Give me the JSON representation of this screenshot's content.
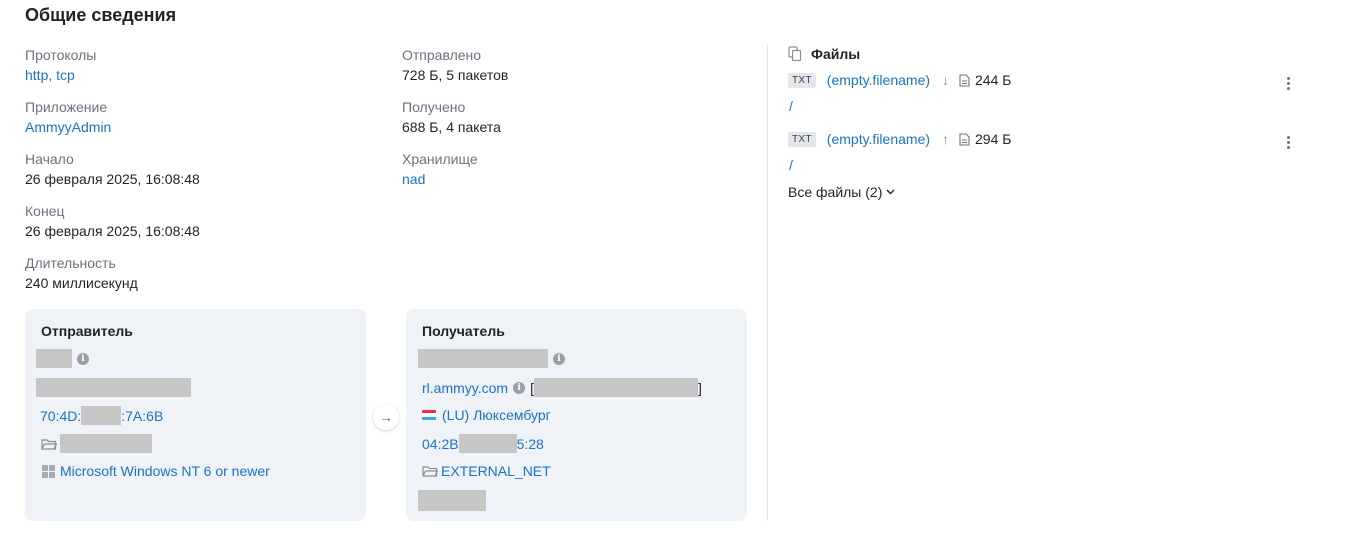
{
  "section_title": "Общие сведения",
  "info": {
    "protocols": {
      "label": "Протоколы",
      "items": [
        "http",
        "tcp"
      ],
      "separator": ", "
    },
    "application": {
      "label": "Приложение",
      "value": "AmmyyAdmin"
    },
    "start": {
      "label": "Начало",
      "value": "26 февраля 2025, 16:08:48"
    },
    "end": {
      "label": "Конец",
      "value": "26 февраля 2025, 16:08:48"
    },
    "duration": {
      "label": "Длительность",
      "value": "240 миллисекунд"
    },
    "sent": {
      "label": "Отправлено",
      "value": "728 Б, 5 пакетов"
    },
    "received": {
      "label": "Получено",
      "value": "688 Б, 4 пакета"
    },
    "storage": {
      "label": "Хранилище",
      "value": "nad"
    }
  },
  "sender": {
    "title": "Отправитель",
    "mac_start": "70:4D:",
    "mac_end": ":7A:6B",
    "os": "Microsoft Windows NT 6 or newer"
  },
  "receiver": {
    "title": "Получатель",
    "host": "rl.ammyy.com",
    "bracket_open": "[",
    "bracket_close": "]",
    "country": "(LU) Люксембург",
    "mac_start": "04:2B",
    "mac_end": "5:28",
    "network": "EXTERNAL_NET"
  },
  "arrow": "→",
  "files": {
    "title": "Файлы",
    "items": [
      {
        "type": "TXT",
        "name": "(empty.filename)",
        "direction": "↓",
        "size": "244 Б",
        "path": "/"
      },
      {
        "type": "TXT",
        "name": "(empty.filename)",
        "direction": "↑",
        "size": "294 Б",
        "path": "/"
      }
    ],
    "all_files": "Все файлы (2)"
  },
  "icons": {
    "info": "info-icon",
    "folder": "folder-icon",
    "windows": "windows-icon",
    "flag": "luxembourg-flag-icon",
    "files": "files-icon",
    "document": "document-icon",
    "more": "kebab-menu-icon",
    "chevron": "chevron-down-icon"
  },
  "colors": {
    "link": "#1a73c8",
    "card_bg": "#eff2f7",
    "redaction": "#c6c6c6",
    "flag": [
      "#e8363d",
      "#ffffff",
      "#3ea4e0"
    ]
  }
}
